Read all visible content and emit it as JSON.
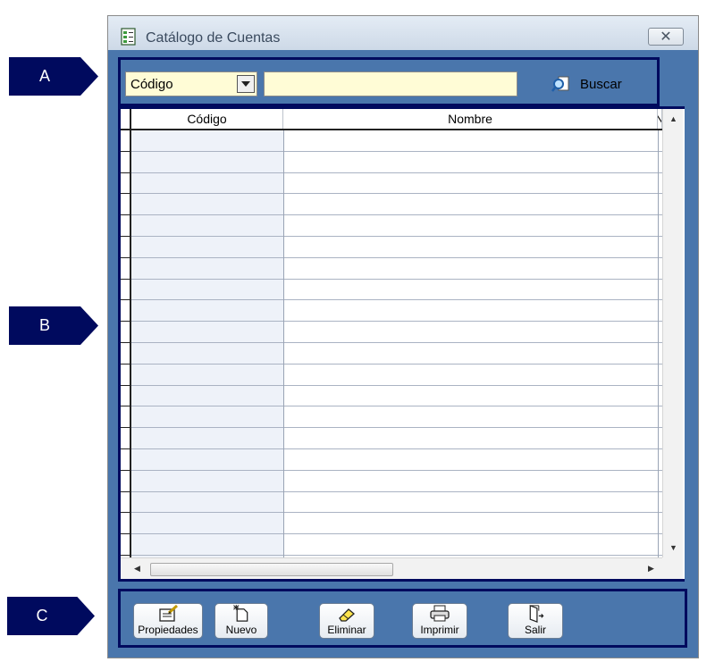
{
  "callouts": {
    "a": "A",
    "b": "B",
    "c": "C"
  },
  "window": {
    "title": "Catálogo de Cuentas",
    "close_symbol": "✕"
  },
  "search": {
    "field_selected": "Código",
    "query_value": "",
    "button_label": "Buscar"
  },
  "grid": {
    "columns": [
      "Código",
      "Nombre",
      "N"
    ],
    "row_count": 20
  },
  "toolbar": {
    "propiedades": "Propiedades",
    "nuevo": "Nuevo",
    "eliminar": "Eliminar",
    "imprimir": "Imprimir",
    "salir": "Salir"
  },
  "icons": {
    "app": "spreadsheet-icon",
    "buscar": "magnifier-icon",
    "propiedades": "edit-document-icon",
    "nuevo": "new-document-icon",
    "eliminar": "eraser-icon",
    "imprimir": "printer-icon",
    "salir": "exit-door-icon"
  },
  "colors": {
    "navy": "#000a5e",
    "panel": "#4a76ac",
    "field": "#fffcd6"
  }
}
